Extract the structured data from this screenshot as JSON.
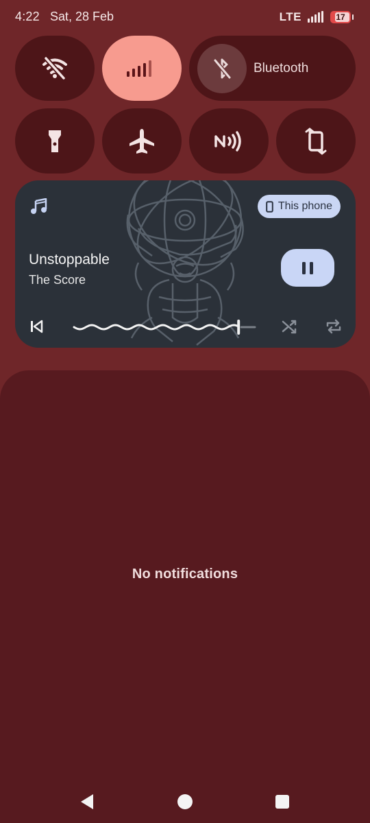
{
  "status_bar": {
    "time": "4:22",
    "date": "Sat, 28 Feb",
    "network_type": "LTE",
    "battery_level": "17"
  },
  "quick_settings": {
    "tiles": [
      {
        "id": "wifi",
        "icon": "wifi-off-icon",
        "active": false
      },
      {
        "id": "mobile-data",
        "icon": "signal-icon",
        "active": true
      },
      {
        "id": "bluetooth",
        "icon": "bluetooth-off-icon",
        "label": "Bluetooth",
        "active": false
      },
      {
        "id": "flashlight",
        "icon": "flashlight-icon",
        "active": false
      },
      {
        "id": "airplane",
        "icon": "airplane-icon",
        "active": false
      },
      {
        "id": "nfc",
        "icon": "nfc-icon",
        "active": false
      },
      {
        "id": "auto-rotate",
        "icon": "rotate-icon",
        "active": false
      }
    ]
  },
  "media": {
    "title": "Unstoppable",
    "artist": "The Score",
    "output_device": "This phone",
    "progress_fraction": 0.91,
    "colors": {
      "card_bg": "#2b3139",
      "button_bg": "#c9d6f6"
    }
  },
  "notifications": {
    "empty_text": "No notifications"
  },
  "colors": {
    "background": "#6f2629",
    "tile": "#4d1518",
    "tile_active": "#f79b8f",
    "panel": "#571a1f"
  }
}
